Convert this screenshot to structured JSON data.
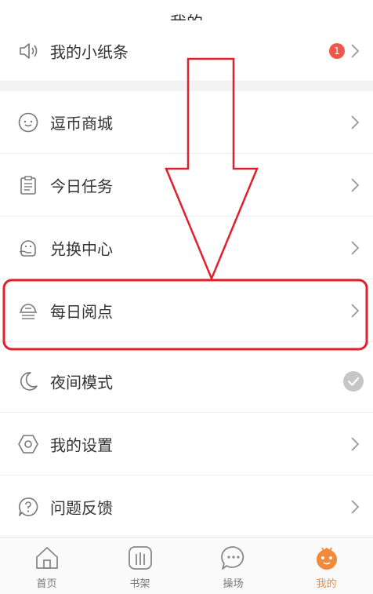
{
  "header": {
    "title": "我的"
  },
  "menu": {
    "items": [
      {
        "label": "我的小纸条",
        "icon": "speaker-icon",
        "badge": "1"
      },
      {
        "label": "逗币商城",
        "icon": "smile-coin-icon"
      },
      {
        "label": "今日任务",
        "icon": "clipboard-icon"
      },
      {
        "label": "兑换中心",
        "icon": "exchange-face-icon"
      },
      {
        "label": "每日阅点",
        "icon": "daily-reading-icon"
      },
      {
        "label": "夜间模式",
        "icon": "moon-icon"
      },
      {
        "label": "我的设置",
        "icon": "hexagon-settings-icon"
      },
      {
        "label": "问题反馈",
        "icon": "question-bubble-icon"
      }
    ]
  },
  "tabs": [
    {
      "label": "首页",
      "icon": "home-icon"
    },
    {
      "label": "书架",
      "icon": "bookshelf-icon"
    },
    {
      "label": "操场",
      "icon": "chat-bubble-icon"
    },
    {
      "label": "我的",
      "icon": "mascot-icon",
      "active": true
    }
  ],
  "colors": {
    "accent": "#f28a3b",
    "badge": "#f0574a",
    "annotation": "#e0202a"
  }
}
